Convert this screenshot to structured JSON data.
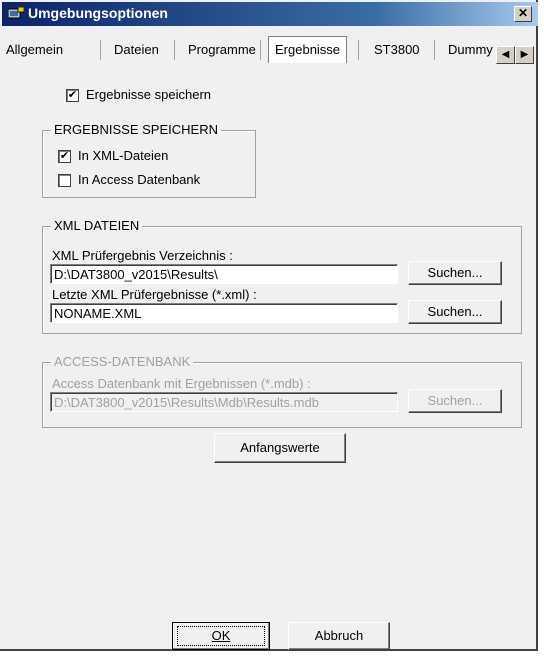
{
  "window": {
    "title": "Umgebungsoptionen",
    "close_label": "✕"
  },
  "tabs": [
    {
      "label": "Allgemein"
    },
    {
      "label": "Dateien"
    },
    {
      "label": "Programme"
    },
    {
      "label": "Ergebnisse",
      "active": true
    },
    {
      "label": "ST3800"
    },
    {
      "label": "Dummy"
    }
  ],
  "tab_scroll": {
    "left": "◀",
    "right": "▶"
  },
  "save_results": {
    "label": "Ergebnisse speichern",
    "checked": true,
    "mark": "✔"
  },
  "save_group": {
    "title": "ERGEBNISSE SPEICHERN",
    "xml_files": {
      "label": "In XML-Dateien",
      "checked": true,
      "mark": "✔"
    },
    "access_db": {
      "label": "In Access Datenbank",
      "checked": false,
      "mark": ""
    }
  },
  "xml_group": {
    "title": "XML DATEIEN",
    "dir_label": "XML Prüfergebnis Verzeichnis :",
    "dir_value": "D:\\DAT3800_v2015\\Results\\",
    "dir_button": "Suchen...",
    "last_label": "Letzte XML Prüfergebnisse (*.xml) :",
    "last_value": "NONAME.XML",
    "last_button": "Suchen..."
  },
  "access_group": {
    "title": "ACCESS-DATENBANK",
    "db_label": "Access Datenbank mit Ergebnissen (*.mdb) :",
    "db_value": "D:\\DAT3800_v2015\\Results\\Mdb\\Results.mdb",
    "db_button": "Suchen..."
  },
  "defaults_button": "Anfangswerte",
  "footer": {
    "ok": "OK",
    "cancel": "Abbruch"
  },
  "colors": {
    "titlebar": "#0a246a",
    "dialog_bg": "#f0f0f0",
    "disabled_text": "#a0a0a0"
  }
}
